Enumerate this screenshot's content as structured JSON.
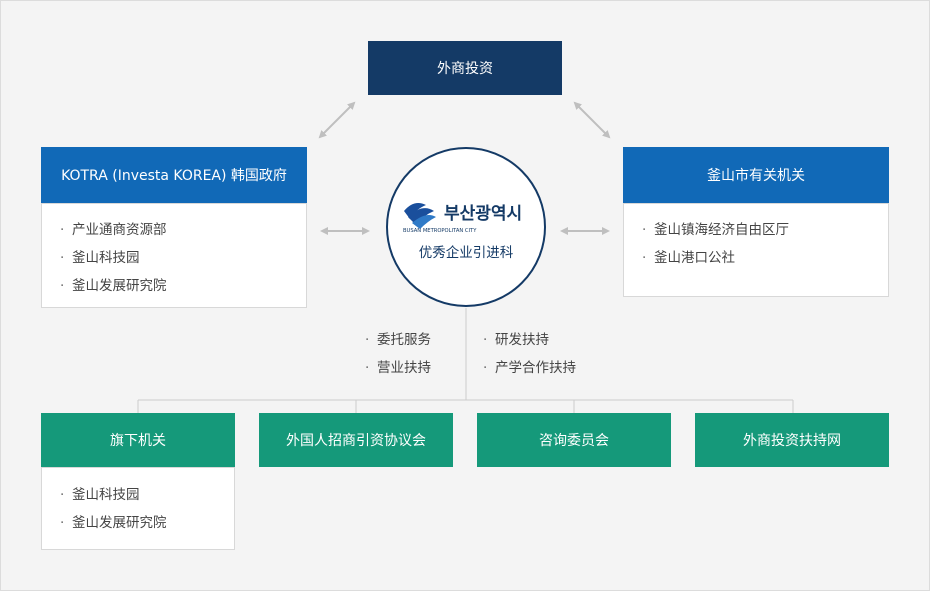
{
  "top": {
    "title": "外商投资"
  },
  "left": {
    "title": "KOTRA (Investa KOREA) 韩国政府",
    "items": [
      "产业通商资源部",
      "釜山科技园",
      "釜山发展研究院"
    ]
  },
  "right": {
    "title": "釜山市有关机关",
    "items": [
      "釜山镇海经济自由区厅",
      "釜山港口公社"
    ]
  },
  "center": {
    "logo_text": "부산광역시",
    "logo_sub": "BUSAN METROPOLITAN CITY",
    "label": "优秀企业引进科"
  },
  "middle_left": {
    "items": [
      "委托服务",
      "营业扶持"
    ]
  },
  "middle_right": {
    "items": [
      "研发扶持",
      "产学合作扶持"
    ]
  },
  "bottom": [
    {
      "title": "旗下机关",
      "items": [
        "釜山科技园",
        "釜山发展研究院"
      ]
    },
    {
      "title": "外国人招商引资协议会"
    },
    {
      "title": "咨询委员会"
    },
    {
      "title": "外商投资扶持网"
    }
  ],
  "bullet": "·",
  "colors": {
    "navy": "#143a66",
    "blue": "#1169b7",
    "green": "#15997a",
    "arrow": "#bfbfbf"
  },
  "icons": {
    "logo": "busan-logo-icon",
    "arrows": "double-arrow-icon"
  }
}
